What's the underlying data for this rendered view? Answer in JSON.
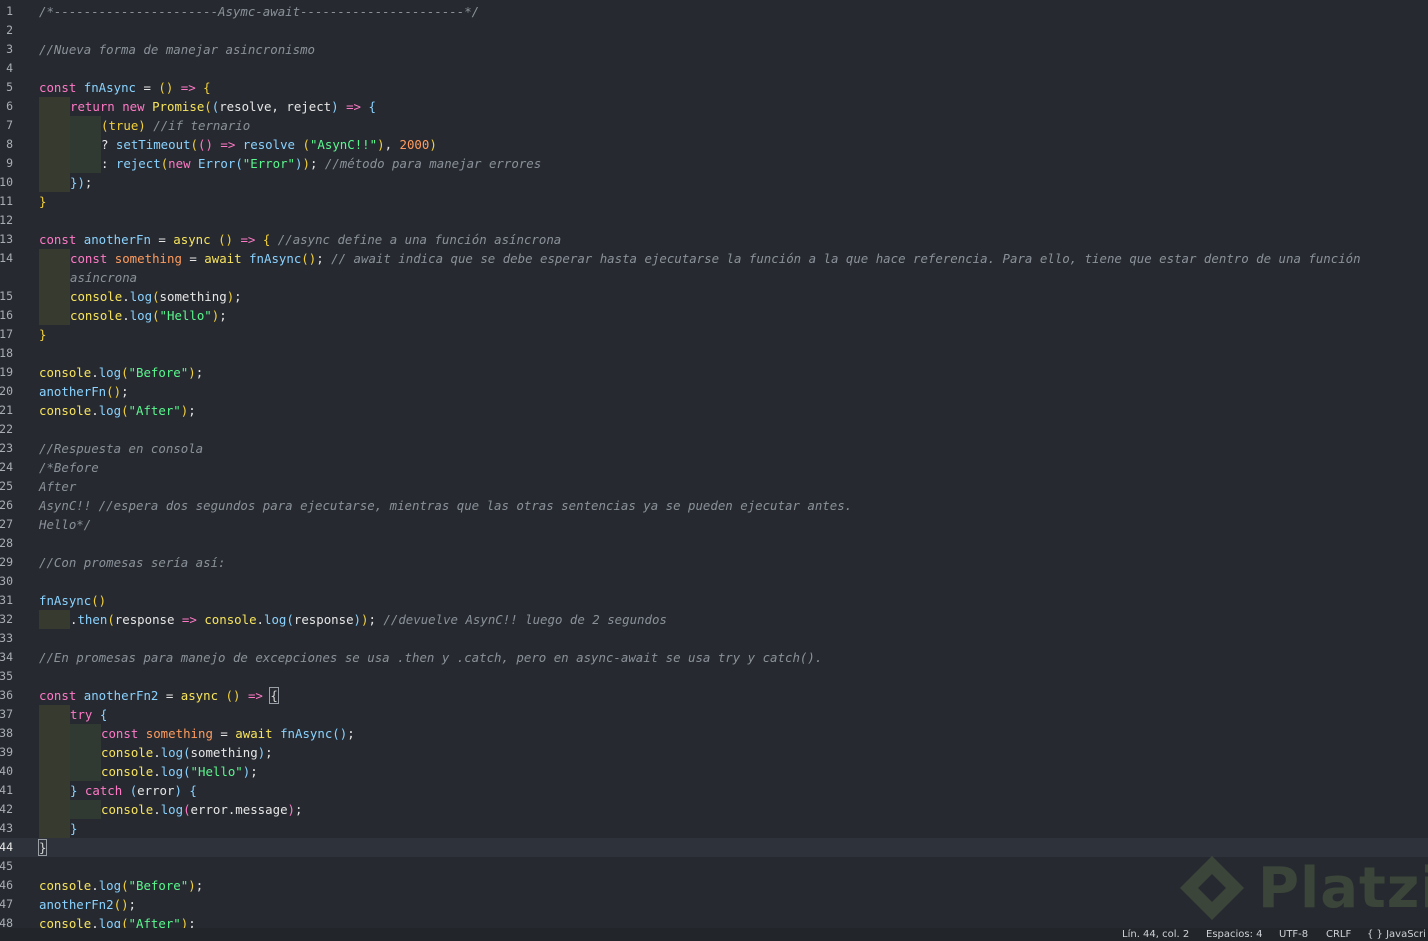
{
  "editor": {
    "current_line": 44,
    "lines": [
      {
        "n": "1",
        "tokens": [
          [
            "c",
            "/*----------------------Asymc-await----------------------*/"
          ]
        ]
      },
      {
        "n": "2",
        "tokens": []
      },
      {
        "n": "3",
        "tokens": [
          [
            "c",
            "//Nueva forma de manejar asincronismo"
          ]
        ]
      },
      {
        "n": "4",
        "tokens": []
      },
      {
        "n": "5",
        "tokens": [
          [
            "k",
            "const "
          ],
          [
            "f",
            "fnAsync"
          ],
          [
            "p",
            " = "
          ],
          [
            "y",
            "()"
          ],
          [
            "p",
            " "
          ],
          [
            "k",
            "=>"
          ],
          [
            "p",
            " "
          ],
          [
            "y",
            "{"
          ]
        ]
      },
      {
        "n": "6",
        "indent": 1,
        "tokens": [
          [
            "k",
            "return new "
          ],
          [
            "kw",
            "Promise"
          ],
          [
            "y",
            "("
          ],
          [
            "f",
            "("
          ],
          [
            "p",
            "resolve, reject"
          ],
          [
            "f",
            ")"
          ],
          [
            "p",
            " "
          ],
          [
            "k",
            "=>"
          ],
          [
            "p",
            " "
          ],
          [
            "f",
            "{"
          ]
        ]
      },
      {
        "n": "7",
        "indent": 2,
        "tokens": [
          [
            "y",
            "(true)"
          ],
          [
            "p",
            " "
          ],
          [
            "c",
            "//if ternario"
          ]
        ]
      },
      {
        "n": "8",
        "indent": 2,
        "tokens": [
          [
            "p",
            "? "
          ],
          [
            "f",
            "setTimeout"
          ],
          [
            "y",
            "("
          ],
          [
            "k",
            "("
          ],
          [
            "k",
            ")"
          ],
          [
            "p",
            " "
          ],
          [
            "k",
            "=>"
          ],
          [
            "p",
            " "
          ],
          [
            "f",
            "resolve"
          ],
          [
            "p",
            " "
          ],
          [
            "y",
            "("
          ],
          [
            "s",
            "\"AsynC!!\""
          ],
          [
            "y",
            ")"
          ],
          [
            "p",
            ", "
          ],
          [
            "n",
            "2000"
          ],
          [
            "y",
            ")"
          ]
        ]
      },
      {
        "n": "9",
        "indent": 2,
        "tokens": [
          [
            "p",
            ": "
          ],
          [
            "f",
            "reject"
          ],
          [
            "y",
            "("
          ],
          [
            "k",
            "new "
          ],
          [
            "f",
            "Error"
          ],
          [
            "f",
            "("
          ],
          [
            "s",
            "\"Error\""
          ],
          [
            "f",
            ")"
          ],
          [
            "y",
            ")"
          ],
          [
            "p",
            "; "
          ],
          [
            "c",
            "//método para manejar errores"
          ]
        ]
      },
      {
        "n": "10",
        "indent": 1,
        "tokens": [
          [
            "f",
            "})"
          ],
          [
            "p",
            ";"
          ]
        ]
      },
      {
        "n": "11",
        "tokens": [
          [
            "y",
            "}"
          ]
        ]
      },
      {
        "n": "12",
        "tokens": []
      },
      {
        "n": "13",
        "tokens": [
          [
            "k",
            "const "
          ],
          [
            "f",
            "anotherFn"
          ],
          [
            "p",
            " = "
          ],
          [
            "kw",
            "async"
          ],
          [
            "p",
            " "
          ],
          [
            "y",
            "()"
          ],
          [
            "p",
            " "
          ],
          [
            "k",
            "=>"
          ],
          [
            "p",
            " "
          ],
          [
            "y",
            "{"
          ],
          [
            "p",
            " "
          ],
          [
            "c",
            "//async define a una función asíncrona"
          ]
        ]
      },
      {
        "n": "14",
        "indent": 1,
        "tokens": [
          [
            "k",
            "const "
          ],
          [
            "n",
            "something"
          ],
          [
            "p",
            " = "
          ],
          [
            "kw",
            "await"
          ],
          [
            "p",
            " "
          ],
          [
            "f",
            "fnAsync"
          ],
          [
            "y",
            "()"
          ],
          [
            "p",
            "; "
          ],
          [
            "c",
            "// await indica que se debe esperar hasta ejecutarse la función a la que hace referencia. Para ello, tiene que estar dentro de una función"
          ]
        ]
      },
      {
        "n": "",
        "indent": 1,
        "tokens": [
          [
            "c",
            "asíncrona"
          ]
        ]
      },
      {
        "n": "15",
        "indent": 1,
        "tokens": [
          [
            "kw",
            "console"
          ],
          [
            "p",
            "."
          ],
          [
            "f",
            "log"
          ],
          [
            "y",
            "("
          ],
          [
            "p",
            "something"
          ],
          [
            "y",
            ")"
          ],
          [
            "p",
            ";"
          ]
        ]
      },
      {
        "n": "16",
        "indent": 1,
        "tokens": [
          [
            "kw",
            "console"
          ],
          [
            "p",
            "."
          ],
          [
            "f",
            "log"
          ],
          [
            "y",
            "("
          ],
          [
            "s",
            "\"Hello\""
          ],
          [
            "y",
            ")"
          ],
          [
            "p",
            ";"
          ]
        ]
      },
      {
        "n": "17",
        "tokens": [
          [
            "y",
            "}"
          ]
        ]
      },
      {
        "n": "18",
        "tokens": []
      },
      {
        "n": "19",
        "tokens": [
          [
            "kw",
            "console"
          ],
          [
            "p",
            "."
          ],
          [
            "f",
            "log"
          ],
          [
            "y",
            "("
          ],
          [
            "s",
            "\"Before\""
          ],
          [
            "y",
            ")"
          ],
          [
            "p",
            ";"
          ]
        ]
      },
      {
        "n": "20",
        "tokens": [
          [
            "f",
            "anotherFn"
          ],
          [
            "y",
            "()"
          ],
          [
            "p",
            ";"
          ]
        ]
      },
      {
        "n": "21",
        "tokens": [
          [
            "kw",
            "console"
          ],
          [
            "p",
            "."
          ],
          [
            "f",
            "log"
          ],
          [
            "y",
            "("
          ],
          [
            "s",
            "\"After\""
          ],
          [
            "y",
            ")"
          ],
          [
            "p",
            ";"
          ]
        ]
      },
      {
        "n": "22",
        "tokens": []
      },
      {
        "n": "23",
        "tokens": [
          [
            "c",
            "//Respuesta en consola"
          ]
        ]
      },
      {
        "n": "24",
        "tokens": [
          [
            "c",
            "/*Before"
          ]
        ]
      },
      {
        "n": "25",
        "tokens": [
          [
            "c",
            "After"
          ]
        ]
      },
      {
        "n": "26",
        "tokens": [
          [
            "c",
            "AsynC!! //espera dos segundos para ejecutarse, mientras que las otras sentencias ya se pueden ejecutar antes."
          ]
        ]
      },
      {
        "n": "27",
        "tokens": [
          [
            "c",
            "Hello*/"
          ]
        ]
      },
      {
        "n": "28",
        "tokens": []
      },
      {
        "n": "29",
        "tokens": [
          [
            "c",
            "//Con promesas sería así:"
          ]
        ]
      },
      {
        "n": "30",
        "tokens": []
      },
      {
        "n": "31",
        "tokens": [
          [
            "f",
            "fnAsync"
          ],
          [
            "y",
            "()"
          ]
        ]
      },
      {
        "n": "32",
        "indent": 1,
        "tokens": [
          [
            "p",
            "."
          ],
          [
            "f",
            "then"
          ],
          [
            "y",
            "("
          ],
          [
            "p",
            "response "
          ],
          [
            "k",
            "=>"
          ],
          [
            "p",
            " "
          ],
          [
            "kw",
            "console"
          ],
          [
            "p",
            "."
          ],
          [
            "f",
            "log"
          ],
          [
            "f",
            "("
          ],
          [
            "p",
            "response"
          ],
          [
            "f",
            ")"
          ],
          [
            "y",
            ")"
          ],
          [
            "p",
            "; "
          ],
          [
            "c",
            "//devuelve AsynC!! luego de 2 segundos"
          ]
        ]
      },
      {
        "n": "33",
        "tokens": []
      },
      {
        "n": "34",
        "tokens": [
          [
            "c",
            "//En promesas para manejo de excepciones se usa .then y .catch, pero en async-await se usa try y catch()."
          ]
        ]
      },
      {
        "n": "35",
        "tokens": []
      },
      {
        "n": "36",
        "tokens": [
          [
            "k",
            "const "
          ],
          [
            "f",
            "anotherFn2"
          ],
          [
            "p",
            " = "
          ],
          [
            "kw",
            "async"
          ],
          [
            "p",
            " "
          ],
          [
            "y",
            "()"
          ],
          [
            "p",
            " "
          ],
          [
            "k",
            "=>"
          ],
          [
            "p",
            " "
          ],
          [
            "bm",
            "{"
          ]
        ]
      },
      {
        "n": "37",
        "indent": 1,
        "tokens": [
          [
            "k",
            "try "
          ],
          [
            "f",
            "{"
          ]
        ]
      },
      {
        "n": "38",
        "indent": 2,
        "tokens": [
          [
            "k",
            "const "
          ],
          [
            "n",
            "something"
          ],
          [
            "p",
            " = "
          ],
          [
            "kw",
            "await"
          ],
          [
            "p",
            " "
          ],
          [
            "f",
            "fnAsync"
          ],
          [
            "f",
            "()"
          ],
          [
            "p",
            ";"
          ]
        ]
      },
      {
        "n": "39",
        "indent": 2,
        "tokens": [
          [
            "kw",
            "console"
          ],
          [
            "p",
            "."
          ],
          [
            "f",
            "log"
          ],
          [
            "f",
            "("
          ],
          [
            "p",
            "something"
          ],
          [
            "f",
            ")"
          ],
          [
            "p",
            ";"
          ]
        ]
      },
      {
        "n": "40",
        "indent": 2,
        "tokens": [
          [
            "kw",
            "console"
          ],
          [
            "p",
            "."
          ],
          [
            "f",
            "log"
          ],
          [
            "f",
            "("
          ],
          [
            "s",
            "\"Hello\""
          ],
          [
            "f",
            ")"
          ],
          [
            "p",
            ";"
          ]
        ]
      },
      {
        "n": "41",
        "indent": 1,
        "tokens": [
          [
            "f",
            "} "
          ],
          [
            "k",
            "catch"
          ],
          [
            "p",
            " "
          ],
          [
            "f",
            "("
          ],
          [
            "p",
            "error"
          ],
          [
            "f",
            ")"
          ],
          [
            "p",
            " "
          ],
          [
            "f",
            "{"
          ]
        ]
      },
      {
        "n": "42",
        "indent": 2,
        "tokens": [
          [
            "kw",
            "console"
          ],
          [
            "p",
            "."
          ],
          [
            "f",
            "log"
          ],
          [
            "k",
            "("
          ],
          [
            "p",
            "error.message"
          ],
          [
            "k",
            ")"
          ],
          [
            "p",
            ";"
          ]
        ]
      },
      {
        "n": "43",
        "indent": 1,
        "tokens": [
          [
            "f",
            "}"
          ]
        ]
      },
      {
        "n": "44",
        "current": true,
        "tokens": [
          [
            "bm",
            "}"
          ]
        ]
      },
      {
        "n": "45",
        "tokens": []
      },
      {
        "n": "46",
        "tokens": [
          [
            "kw",
            "console"
          ],
          [
            "p",
            "."
          ],
          [
            "f",
            "log"
          ],
          [
            "y",
            "("
          ],
          [
            "s",
            "\"Before\""
          ],
          [
            "y",
            ")"
          ],
          [
            "p",
            ";"
          ]
        ]
      },
      {
        "n": "47",
        "tokens": [
          [
            "f",
            "anotherFn2"
          ],
          [
            "y",
            "()"
          ],
          [
            "p",
            ";"
          ]
        ]
      },
      {
        "n": "48",
        "tokens": [
          [
            "kw",
            "console"
          ],
          [
            "p",
            "."
          ],
          [
            "f",
            "log"
          ],
          [
            "y",
            "("
          ],
          [
            "s",
            "\"After\""
          ],
          [
            "y",
            ")"
          ],
          [
            "p",
            ";"
          ]
        ]
      }
    ]
  },
  "statusbar": {
    "position": "Lín. 44, col. 2",
    "spaces": "Espacios: 4",
    "encoding": "UTF-8",
    "eol": "CRLF",
    "language": "{ } JavaScri"
  },
  "watermark": {
    "text": "Platzi"
  }
}
